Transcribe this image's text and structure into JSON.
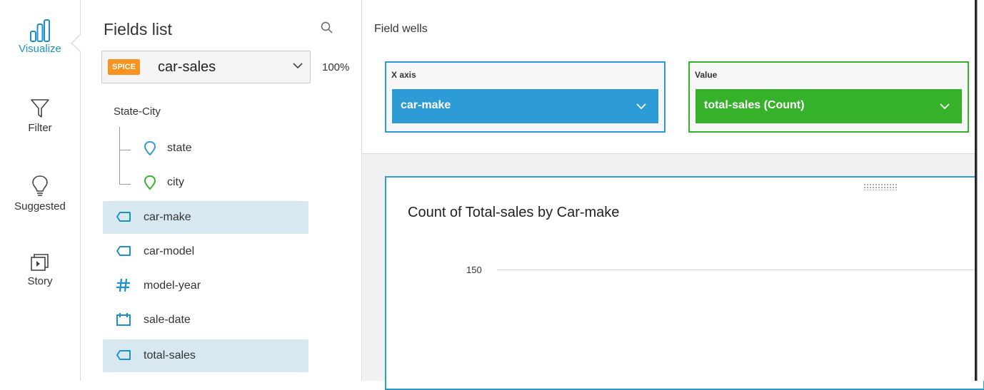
{
  "rail": {
    "items": [
      {
        "label": "Visualize",
        "icon": "bar-chart-icon",
        "active": true
      },
      {
        "label": "Filter",
        "icon": "filter-icon"
      },
      {
        "label": "Suggested",
        "icon": "lightbulb-icon"
      },
      {
        "label": "Story",
        "icon": "story-icon"
      }
    ]
  },
  "fields_panel": {
    "title": "Fields list",
    "dataset": {
      "badge": "SPICE",
      "name": "car-sales"
    },
    "percent": "100%",
    "group": {
      "label": "State-City",
      "children": [
        {
          "label": "state",
          "icon": "location-pin-icon",
          "color": "#2d9bd6"
        },
        {
          "label": "city",
          "icon": "location-pin-icon",
          "color": "#35b12a"
        }
      ]
    },
    "fields": [
      {
        "label": "car-make",
        "icon": "dimension-tag-icon",
        "selected": true
      },
      {
        "label": "car-model",
        "icon": "dimension-tag-icon",
        "selected": false
      },
      {
        "label": "model-year",
        "icon": "hash-icon",
        "selected": false
      },
      {
        "label": "sale-date",
        "icon": "calendar-icon",
        "selected": false
      },
      {
        "label": "total-sales",
        "icon": "dimension-tag-icon",
        "selected": true
      }
    ]
  },
  "field_wells": {
    "title": "Field wells",
    "x_axis": {
      "label": "X axis",
      "value": "car-make",
      "color": "#2d9bd6"
    },
    "value": {
      "label": "Value",
      "value": "total-sales (Count)",
      "color": "#35b12a"
    }
  },
  "visual": {
    "title": "Count of Total-sales by Car-make",
    "y_tick": "150"
  },
  "colors": {
    "accent": "#1a90d0",
    "selected_row": "#d8e8f1",
    "spice": "#f7931e"
  }
}
